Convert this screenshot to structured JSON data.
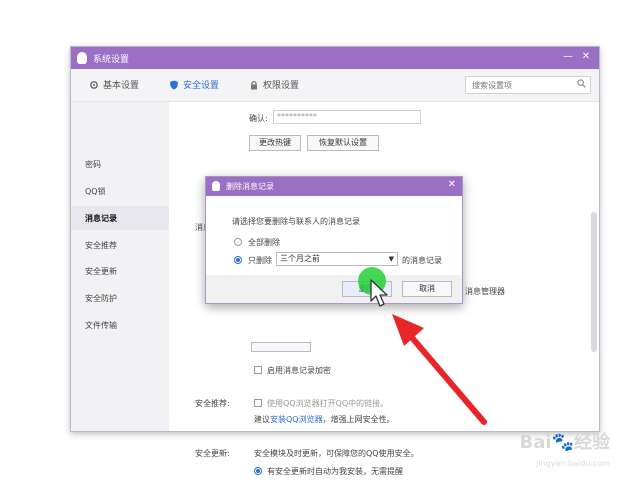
{
  "window": {
    "title": "系统设置",
    "tabs": [
      {
        "label": "基本设置",
        "icon": "gear-icon"
      },
      {
        "label": "安全设置",
        "icon": "shield-icon",
        "active": true
      },
      {
        "label": "权限设置",
        "icon": "lock-icon"
      }
    ],
    "search_placeholder": "搜索设置项"
  },
  "sidebar": {
    "items": [
      {
        "label": "密码"
      },
      {
        "label": "QQ锁"
      },
      {
        "label": "消息记录",
        "active": true
      },
      {
        "label": "安全推荐"
      },
      {
        "label": "安全更新"
      },
      {
        "label": "安全防护"
      },
      {
        "label": "文件传输"
      }
    ]
  },
  "content": {
    "confirm_label": "确认:",
    "password_value": "**********",
    "btn_change_shortcut": "更改热键",
    "btn_restore_default": "恢复默认设置",
    "msg_record_label": "消息记",
    "open_manager_text": "消息管理器",
    "enable_encrypt_label": "启用消息记录加密",
    "security_recommend_label": "安全推荐:",
    "security_recommend_text": "使用QQ浏览器打开QQ中的链接。",
    "security_recommend_text2_a": "建议",
    "security_recommend_link": "安装QQ浏览器",
    "security_recommend_text2_b": "，增强上网安全性。",
    "security_update_label": "安全更新:",
    "security_update_text": "安全模块及时更新，可保障您的QQ使用安全。",
    "security_update_option": "有安全更新时自动为我安装，无需提醒"
  },
  "dialog": {
    "title": "删除消息记录",
    "prompt": "请选择您要删除与联系人的消息记录",
    "option_all": "全部删除",
    "option_only": "只删除",
    "select_value": "三个月之前",
    "option_suffix": "的消息记录",
    "btn_confirm": "删除",
    "btn_cancel": "取消"
  },
  "watermark": {
    "brand": "Bai",
    "brand2": "经验",
    "url": "jingyan.baidu.com"
  },
  "colors": {
    "titlebar": "#9a6fc4",
    "accent": "#2f6fd0",
    "arrow": "#e8262a",
    "highlight": "#26d03a"
  }
}
